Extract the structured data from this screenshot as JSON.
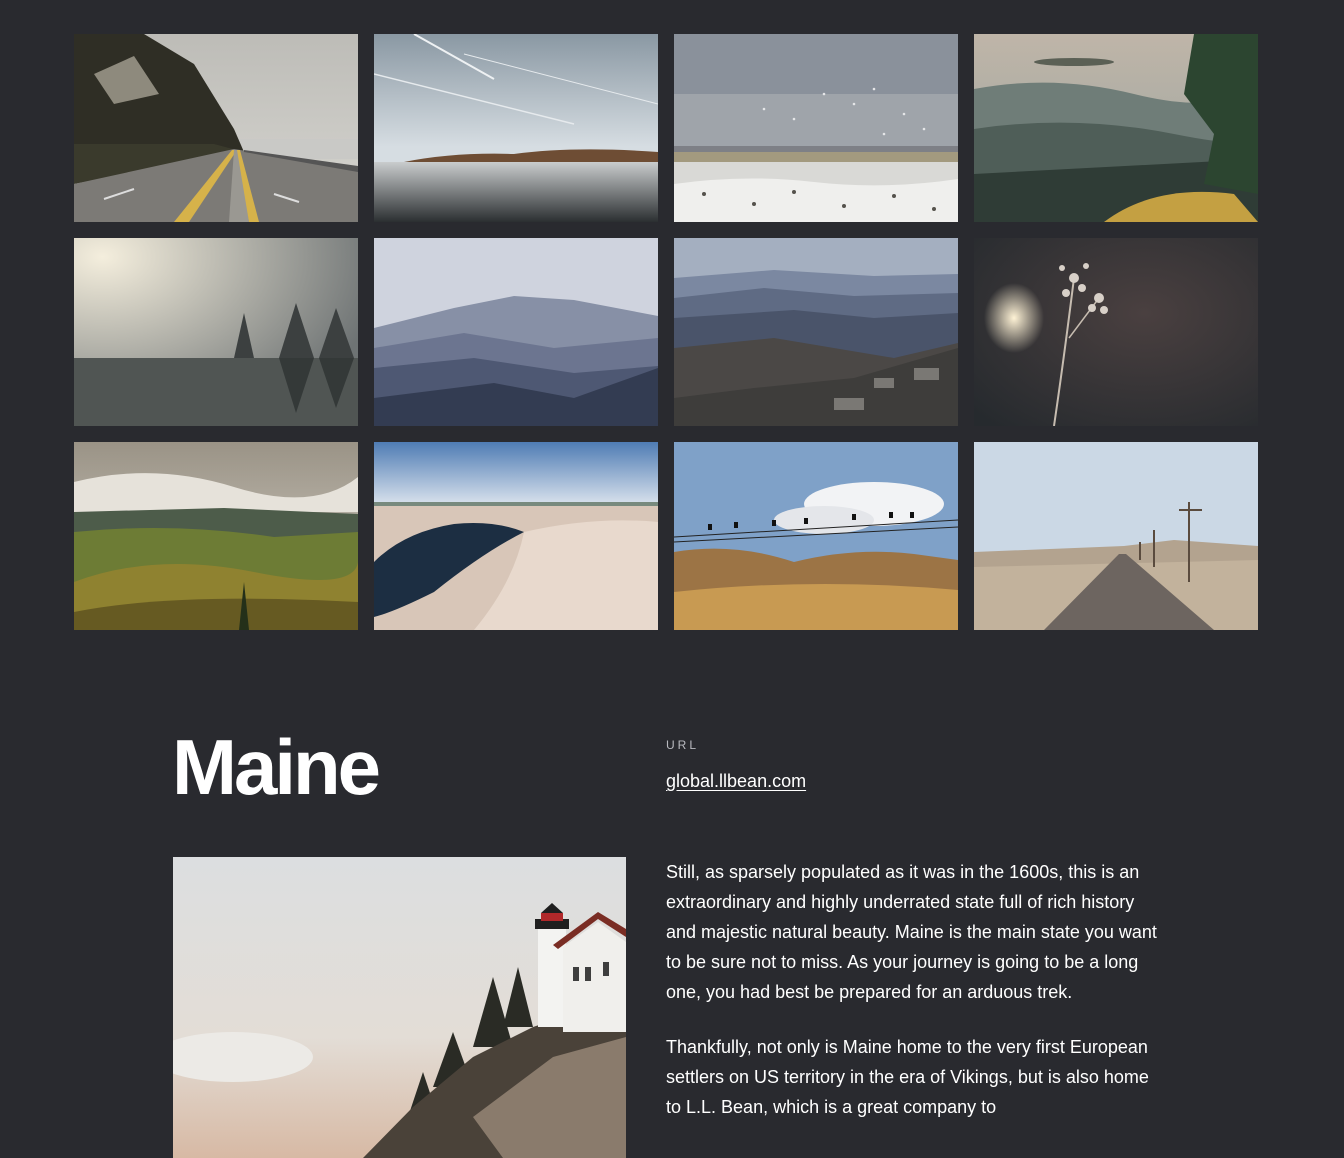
{
  "gallery": {
    "images": [
      {
        "name": "cliffside-highway-photo"
      },
      {
        "name": "calm-lake-sky-photo"
      },
      {
        "name": "snow-geese-field-photo"
      },
      {
        "name": "misty-forest-valley-photo"
      },
      {
        "name": "foggy-lake-trees-photo"
      },
      {
        "name": "blue-mountain-ranges-photo"
      },
      {
        "name": "rocky-mountain-overlook-photo"
      },
      {
        "name": "dried-wildflower-photo"
      },
      {
        "name": "green-hills-valley-photo"
      },
      {
        "name": "sand-dunes-lake-photo"
      },
      {
        "name": "birds-on-wire-hills-photo"
      },
      {
        "name": "desert-road-poles-photo"
      }
    ]
  },
  "article": {
    "title": "Maine",
    "url_label": "URL",
    "url_text": "global.llbean.com",
    "paragraphs": [
      "Still, as sparsely populated as it was in the 1600s, this is an extraordinary and highly underrated state full of rich history and majestic natural beauty. Maine is the main state you want to be sure not to miss. As your journey is going to be a long one, you had best be prepared for an arduous trek.",
      "Thankfully, not only is Maine home to the very first European settlers on US territory in the era of Vikings, but is also home to L.L. Bean, which is a great company to"
    ],
    "feature_image": {
      "name": "lighthouse-cliff-photo"
    }
  },
  "colors": {
    "background": "#292a2f",
    "text": "#ffffff",
    "muted": "#b9bac0"
  }
}
